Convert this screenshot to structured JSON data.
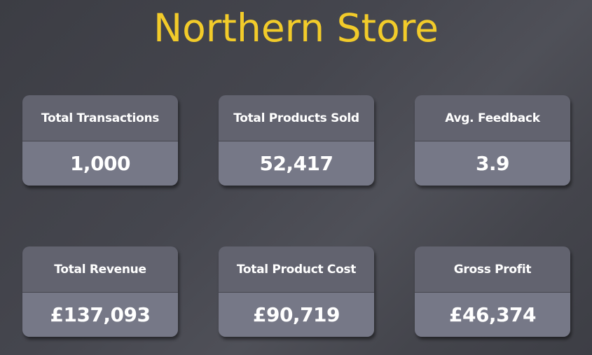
{
  "title": "Northern Store",
  "colors": {
    "title": "#f2cb2a",
    "card_header": "#62636f",
    "card_body": "#767887",
    "background": "#45464e"
  },
  "cards": [
    {
      "label": "Total Transactions",
      "value": "1,000"
    },
    {
      "label": "Total Products Sold",
      "value": "52,417"
    },
    {
      "label": "Avg. Feedback",
      "value": "3.9"
    },
    {
      "label": "Total Revenue",
      "value": "£137,093"
    },
    {
      "label": "Total Product Cost",
      "value": "£90,719"
    },
    {
      "label": "Gross Profit",
      "value": "£46,374"
    }
  ]
}
